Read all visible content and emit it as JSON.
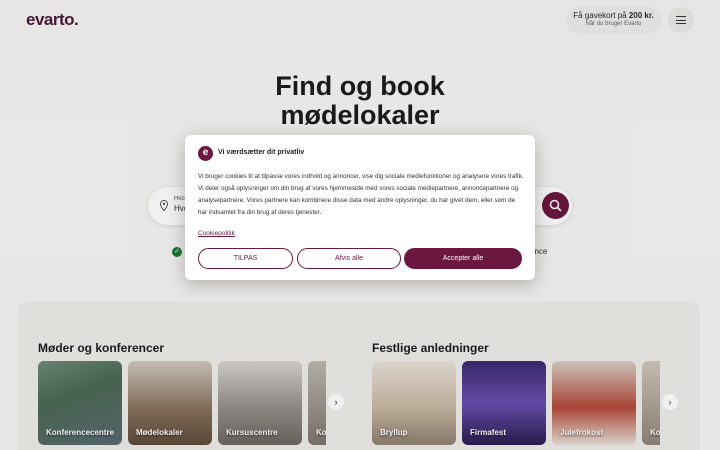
{
  "header": {
    "logo": "evarto.",
    "gift_prefix": "Få gavekort på",
    "gift_amount": "200 kr.",
    "gift_sub": "Når du bruger Evarto"
  },
  "hero": {
    "title_line1": "Find og book",
    "title_line2": "mødelokaler"
  },
  "search": {
    "label": "Hvor",
    "value": "Hvo",
    "usp_tail": "ence"
  },
  "sections": {
    "meetings": {
      "title": "Møder og konferencer",
      "cards": [
        "Konferencecentre",
        "Mødelokaler",
        "Kursuscentre",
        "Ko"
      ]
    },
    "parties": {
      "title": "Festlige anledninger",
      "cards": [
        "Bryllup",
        "Firmafest",
        "Julefrokost",
        "Ko"
      ]
    }
  },
  "cookie": {
    "title": "Vi værdsætter dit privatliv",
    "body": "Vi bruger cookies til at tilpasse vores indhold og annoncer, vise dig sociale mediefunktioner og analysere vores trafik. Vi deler også oplysninger om din brug af vores hjemmeside med vores sociale mediepartnere, annoncepartnere og analysepartnere. Vores partnere kan kombinere disse data med andre oplysninger, du har givet dem, eller som de har indsamlet fra din brug af deres tjenester.",
    "policy_link": "Cookiepolitik",
    "btn_customize": "TILPAS",
    "btn_decline": "Afvis alle",
    "btn_accept": "Accepter alle"
  },
  "colors": {
    "brand": "#6b1740",
    "background": "#f7f6f4"
  }
}
